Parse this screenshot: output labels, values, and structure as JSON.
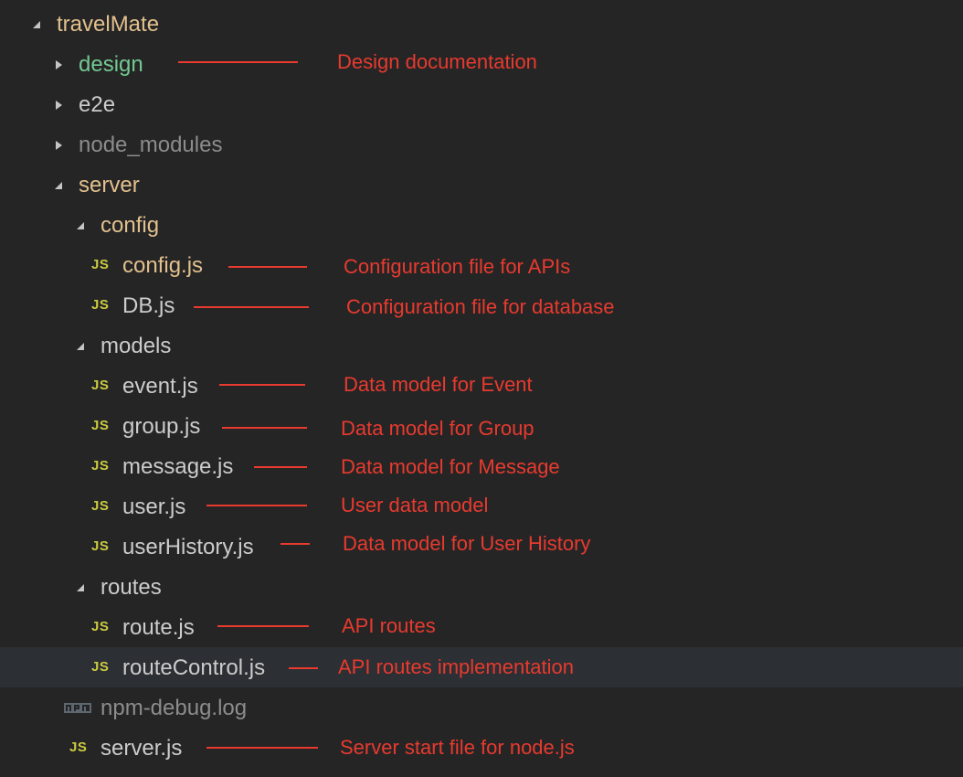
{
  "colors": {
    "background": "#252526",
    "selected_row": "#2c2f33",
    "folder_text": "#e2c08d",
    "modified_text": "#73c991",
    "default_text": "#cccccc",
    "ignored_text": "#8c8c8c",
    "js_badge": "#cbcb41",
    "annotation": "#e83a2e"
  },
  "tree": [
    {
      "label": "travelMate",
      "kind": "folder",
      "expanded": true,
      "state": "folder",
      "selected": false
    },
    {
      "label": "design",
      "kind": "folder",
      "expanded": false,
      "state": "modified",
      "selected": false,
      "annotation": "Design documentation"
    },
    {
      "label": "e2e",
      "kind": "folder",
      "expanded": false,
      "state": "default",
      "selected": false
    },
    {
      "label": "node_modules",
      "kind": "folder",
      "expanded": false,
      "state": "ignored",
      "selected": false
    },
    {
      "label": "server",
      "kind": "folder",
      "expanded": true,
      "state": "folder",
      "selected": false
    },
    {
      "label": "config",
      "kind": "folder",
      "expanded": true,
      "state": "folder",
      "selected": false
    },
    {
      "label": "config.js",
      "kind": "file",
      "icon": "js-file-icon",
      "badge": "JS",
      "state": "folder",
      "selected": false,
      "annotation": "Configuration file for APIs"
    },
    {
      "label": "DB.js",
      "kind": "file",
      "icon": "js-file-icon",
      "badge": "JS",
      "state": "default",
      "selected": false,
      "annotation": "Configuration file for database"
    },
    {
      "label": "models",
      "kind": "folder",
      "expanded": true,
      "state": "default",
      "selected": false
    },
    {
      "label": "event.js",
      "kind": "file",
      "icon": "js-file-icon",
      "badge": "JS",
      "state": "default",
      "selected": false,
      "annotation": "Data model for Event"
    },
    {
      "label": "group.js",
      "kind": "file",
      "icon": "js-file-icon",
      "badge": "JS",
      "state": "default",
      "selected": false,
      "annotation": "Data model for Group"
    },
    {
      "label": "message.js",
      "kind": "file",
      "icon": "js-file-icon",
      "badge": "JS",
      "state": "default",
      "selected": false,
      "annotation": "Data model for Message"
    },
    {
      "label": "user.js",
      "kind": "file",
      "icon": "js-file-icon",
      "badge": "JS",
      "state": "default",
      "selected": false,
      "annotation": "User data model"
    },
    {
      "label": "userHistory.js",
      "kind": "file",
      "icon": "js-file-icon",
      "badge": "JS",
      "state": "default",
      "selected": false,
      "annotation": "Data model for User History"
    },
    {
      "label": "routes",
      "kind": "folder",
      "expanded": true,
      "state": "default",
      "selected": false
    },
    {
      "label": "route.js",
      "kind": "file",
      "icon": "js-file-icon",
      "badge": "JS",
      "state": "default",
      "selected": false,
      "annotation": "API routes"
    },
    {
      "label": "routeControl.js",
      "kind": "file",
      "icon": "js-file-icon",
      "badge": "JS",
      "state": "default",
      "selected": true,
      "annotation": "API routes implementation"
    },
    {
      "label": "npm-debug.log",
      "kind": "file",
      "icon": "npm-log-icon",
      "badge": "npm",
      "state": "ignored",
      "selected": false
    },
    {
      "label": "server.js",
      "kind": "file",
      "icon": "js-file-icon",
      "badge": "JS",
      "state": "default",
      "selected": false,
      "annotation": "Server start file for node.js"
    }
  ]
}
